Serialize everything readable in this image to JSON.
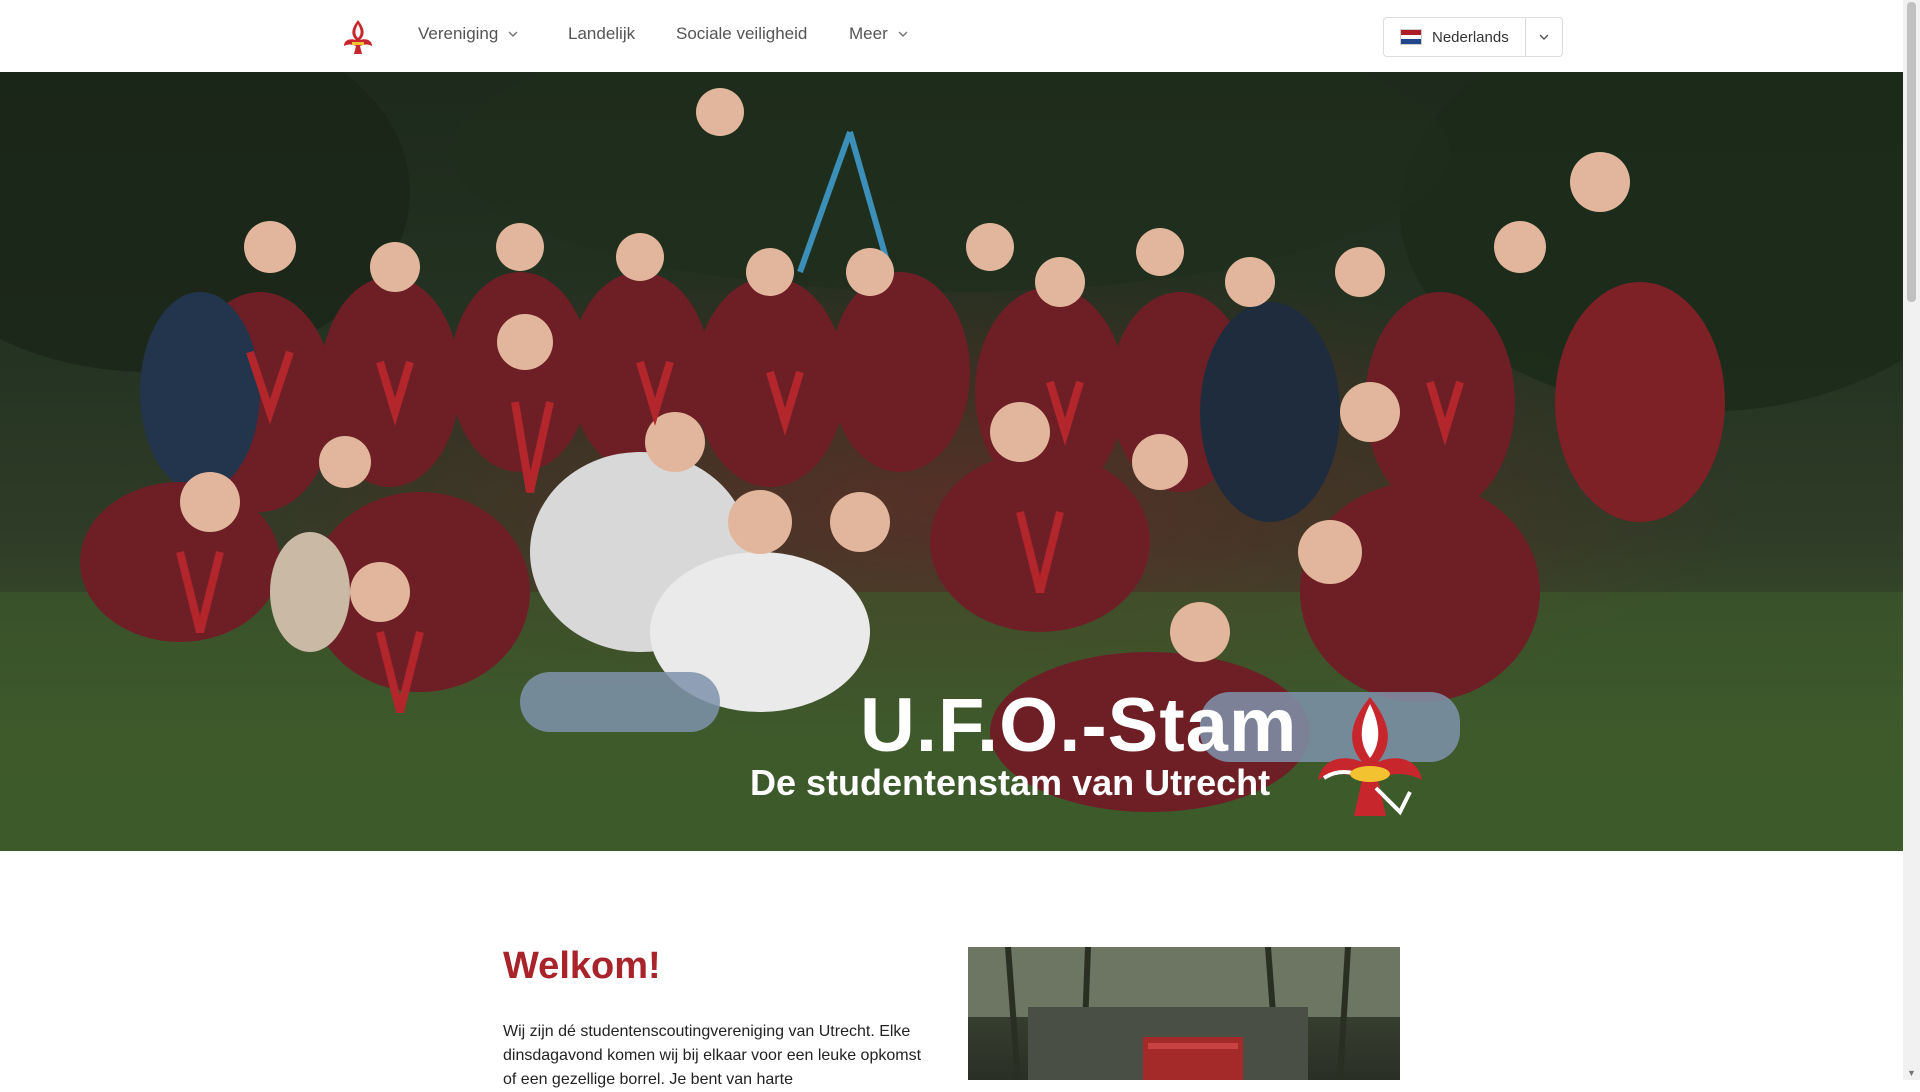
{
  "nav": {
    "items": [
      {
        "label": "Vereniging",
        "has_dropdown": true
      },
      {
        "label": "Landelijk",
        "has_dropdown": false
      },
      {
        "label": "Sociale veiligheid",
        "has_dropdown": false
      },
      {
        "label": "Meer",
        "has_dropdown": true
      }
    ],
    "language": "Nederlands"
  },
  "hero": {
    "title": "U.F.O.-Stam",
    "subtitle": "De studentenstam van Utrecht"
  },
  "content": {
    "heading": "Welkom!",
    "intro": "Wij zijn dé studentenscoutingvereniging van Utrecht. Elke dinsdagavond komen wij bij elkaar voor een leuke opkomst of een gezellige borrel. Je bent van harte"
  },
  "colors": {
    "accent": "#a8232a",
    "scarf_red": "#b3262c",
    "hoodie": "#6e1f26"
  }
}
